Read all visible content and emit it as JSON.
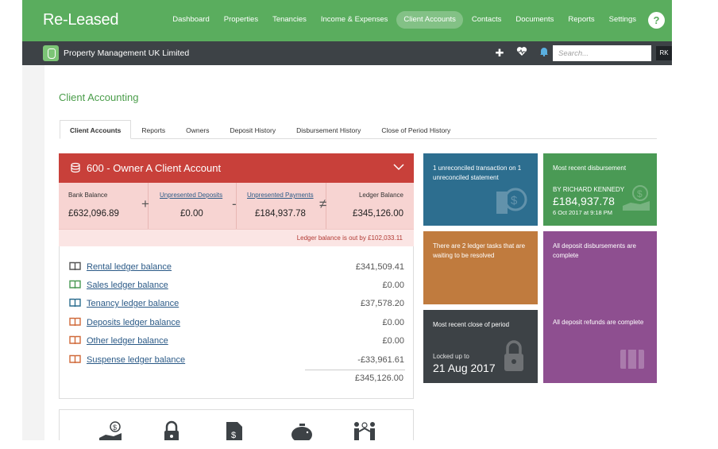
{
  "app": {
    "logo": "Re-Leased"
  },
  "nav": {
    "items": [
      "Dashboard",
      "Properties",
      "Tenancies",
      "Income & Expenses",
      "Client Accounts",
      "Contacts",
      "Documents",
      "Reports",
      "Settings"
    ],
    "active": "Client Accounts",
    "help_label": "?"
  },
  "subbar": {
    "company": "Property Management UK Limited",
    "search_placeholder": "Search...",
    "user_initials": "RK",
    "icons": [
      "plus-icon",
      "heartbeat-icon",
      "bell-icon"
    ]
  },
  "page": {
    "title": "Client Accounting",
    "tabs": [
      "Client Accounts",
      "Reports",
      "Owners",
      "Deposit History",
      "Disbursement History",
      "Close of Period History"
    ],
    "active_tab": "Client Accounts"
  },
  "account": {
    "title": "600 - Owner A Client Account",
    "bank_balance": {
      "label": "Bank Balance",
      "value": "£632,096.89"
    },
    "unpresented_deposits": {
      "label": "Unpresented Deposits",
      "value": "£0.00"
    },
    "unpresented_payments": {
      "label": "Unpresented Payments",
      "value": "£184,937.78"
    },
    "ledger_balance": {
      "label": "Ledger Balance",
      "value": "£345,126.00"
    },
    "operators": [
      "+",
      "-",
      "≠"
    ],
    "warning": "Ledger balance is out by £102,033.11",
    "ledgers": [
      {
        "label": "Rental ledger balance",
        "amount": "£341,509.41",
        "color": "#555555"
      },
      {
        "label": "Sales ledger balance",
        "amount": "£0.00",
        "color": "#4a9a55"
      },
      {
        "label": "Tenancy ledger balance",
        "amount": "£37,578.20",
        "color": "#2d6e8f"
      },
      {
        "label": "Deposits ledger balance",
        "amount": "£0.00",
        "color": "#d06a3a"
      },
      {
        "label": "Other ledger balance",
        "amount": "£0.00",
        "color": "#d06a3a"
      },
      {
        "label": "Suspense ledger balance",
        "amount": "-£33,961.61",
        "color": "#d06a3a"
      }
    ],
    "total": "£345,126.00"
  },
  "tiles": {
    "unreconciled": {
      "text": "1 unreconciled transaction on 1 unreconciled statement",
      "color": "#2d6e8f"
    },
    "disbursement": {
      "title": "Most recent disbursement",
      "by": "BY RICHARD KENNEDY",
      "amount": "£184,937.78",
      "date": "6 Oct 2017 at 9:18 PM",
      "color": "#4a9a55"
    },
    "ledger_tasks": {
      "text": "There are 2 ledger tasks that are waiting to be resolved",
      "color": "#c07b3e"
    },
    "deposits": {
      "text": "All deposit disbursements are complete",
      "refunds": "All deposit refunds are complete",
      "color": "#8e4f90"
    },
    "close_period": {
      "title": "Most recent close of period",
      "locked_label": "Locked up to",
      "date": "21 Aug 2017",
      "color": "#3d4246"
    }
  },
  "bottom_icons": [
    "money-hand-icon",
    "lock-icon",
    "invoice-icon",
    "piggy-bank-icon",
    "handshake-icon"
  ]
}
